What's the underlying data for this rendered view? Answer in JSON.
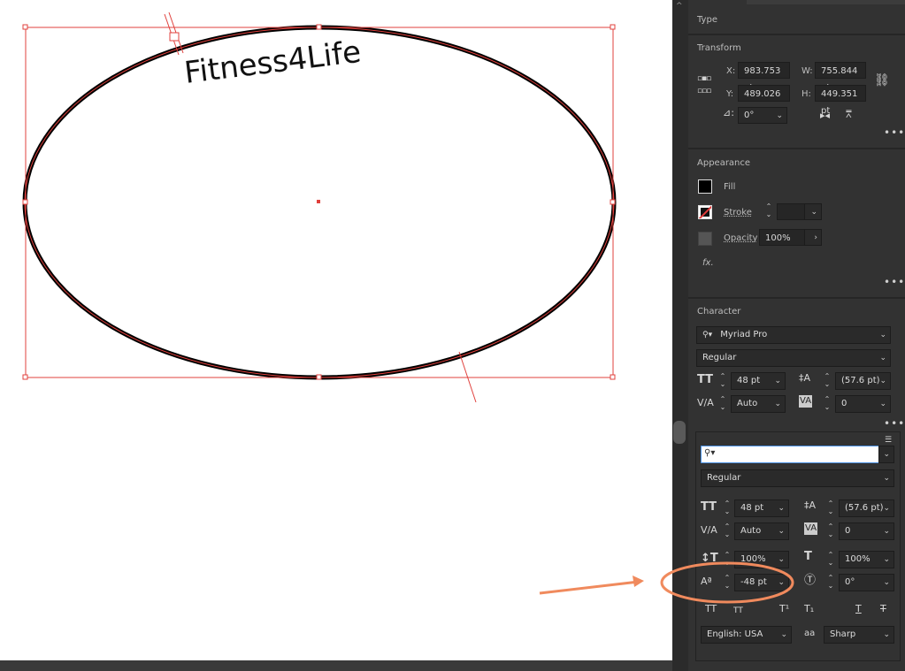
{
  "canvas": {
    "artwork_text": "Fitness4Life"
  },
  "panel": {
    "top_tab": "Type",
    "transform": {
      "title": "Transform",
      "x_label": "X:",
      "x_value": "983.753 pt",
      "y_label": "Y:",
      "y_value": "489.026 pt",
      "w_label": "W:",
      "w_value": "755.844 pt",
      "h_label": "H:",
      "h_value": "449.351 pt",
      "angle_value": "0°"
    },
    "appearance": {
      "title": "Appearance",
      "fill_label": "Fill",
      "stroke_label": "Stroke",
      "opacity_label": "Opacity",
      "opacity_value": "100%",
      "fx_label": "fx."
    },
    "character": {
      "title": "Character",
      "font_family": "Myriad Pro",
      "font_style": "Regular",
      "size_value": "48 pt",
      "leading_value": "(57.6 pt)",
      "kerning_value": "Auto",
      "tracking_value": "0"
    }
  },
  "character_popup": {
    "search_value": "",
    "font_style": "Regular",
    "size_value": "48 pt",
    "leading_value": "(57.6 pt)",
    "kerning_value": "Auto",
    "tracking_value": "0",
    "vscale_value": "100%",
    "hscale_value": "100%",
    "baseline_value": "-48 pt",
    "rotation_value": "0°",
    "language_value": "English: USA",
    "antialias_label": "aa",
    "antialias_value": "Sharp"
  },
  "colors": {
    "panel_bg": "#323232",
    "highlight_circle": "#f08a5d",
    "selection": "#e0403c"
  }
}
